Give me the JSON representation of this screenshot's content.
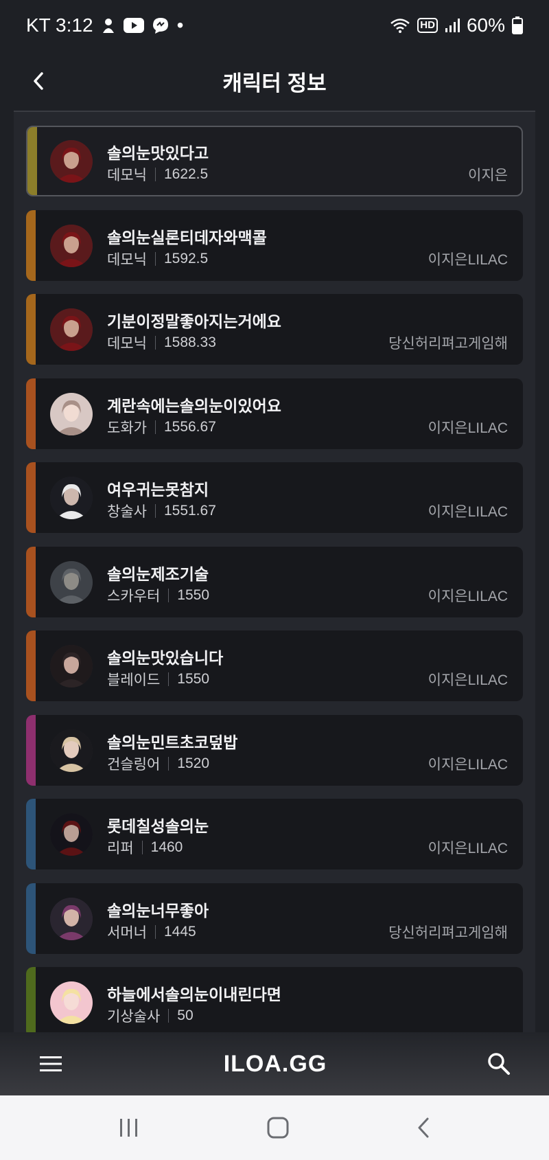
{
  "status_bar": {
    "carrier_time": "KT 3:12",
    "dot": "•",
    "hd": "HD",
    "battery": "60%"
  },
  "header": {
    "title": "캐릭터 정보"
  },
  "characters": [
    {
      "name": "솔의눈맛있다고",
      "class": "데모닉",
      "level": "1622.5",
      "guild": "이지은",
      "accent": "#8c7e2a",
      "active": true
    },
    {
      "name": "솔의눈실론티데자와맥콜",
      "class": "데모닉",
      "level": "1592.5",
      "guild": "이지은LILAC",
      "accent": "#a5671c"
    },
    {
      "name": "기분이정말좋아지는거에요",
      "class": "데모닉",
      "level": "1588.33",
      "guild": "당신허리펴고게임해",
      "accent": "#a5671c"
    },
    {
      "name": "계란속에는솔의눈이있어요",
      "class": "도화가",
      "level": "1556.67",
      "guild": "이지은LILAC",
      "accent": "#a8511f"
    },
    {
      "name": "여우귀는못참지",
      "class": "창술사",
      "level": "1551.67",
      "guild": "이지은LILAC",
      "accent": "#a8511f"
    },
    {
      "name": "솔의눈제조기술",
      "class": "스카우터",
      "level": "1550",
      "guild": "이지은LILAC",
      "accent": "#a8511f"
    },
    {
      "name": "솔의눈맛있습니다",
      "class": "블레이드",
      "level": "1550",
      "guild": "이지은LILAC",
      "accent": "#a8511f"
    },
    {
      "name": "솔의눈민트초코덮밥",
      "class": "건슬링어",
      "level": "1520",
      "guild": "이지은LILAC",
      "accent": "#8e2f6e"
    },
    {
      "name": "롯데칠성솔의눈",
      "class": "리퍼",
      "level": "1460",
      "guild": "이지은LILAC",
      "accent": "#2d5478"
    },
    {
      "name": "솔의눈너무좋아",
      "class": "서머너",
      "level": "1445",
      "guild": "당신허리펴고게임해",
      "accent": "#2d5478"
    },
    {
      "name": "하늘에서솔의눈이내린다면",
      "class": "기상술사",
      "level": "50",
      "guild": "",
      "accent": "#4f6a1d"
    }
  ],
  "bottom_nav": {
    "logo": "ILOA.GG"
  }
}
